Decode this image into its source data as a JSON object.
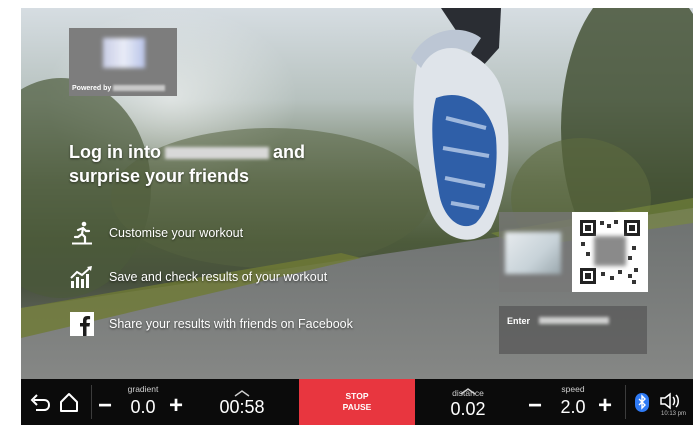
{
  "logo_card": {
    "powered_by_label": "Powered by"
  },
  "headline": {
    "line1_prefix": "Log in into",
    "line1_suffix": "and",
    "line2": "surprise your friends"
  },
  "features": [
    {
      "icon": "running-person-icon",
      "label": "Customise your workout"
    },
    {
      "icon": "growth-chart-icon",
      "label": "Save and check results of your workout"
    },
    {
      "icon": "facebook-icon",
      "label": "Share your results with friends on Facebook"
    }
  ],
  "enter_panel": {
    "label": "Enter"
  },
  "toolbar": {
    "gradient": {
      "label": "gradient",
      "value": "0.0",
      "minus": "−",
      "plus": "+"
    },
    "time": {
      "value": "00:58"
    },
    "stop_button": {
      "line1": "STOP",
      "line2": "PAUSE",
      "color": "#e8363f"
    },
    "distance": {
      "label": "distance",
      "value": "0.02"
    },
    "speed": {
      "label": "speed",
      "value": "2.0",
      "minus": "−",
      "plus": "+"
    },
    "clock": "10:13 pm"
  },
  "colors": {
    "bar_background": "#0b0b0b",
    "bluetooth_blue": "#2f7bf6"
  }
}
